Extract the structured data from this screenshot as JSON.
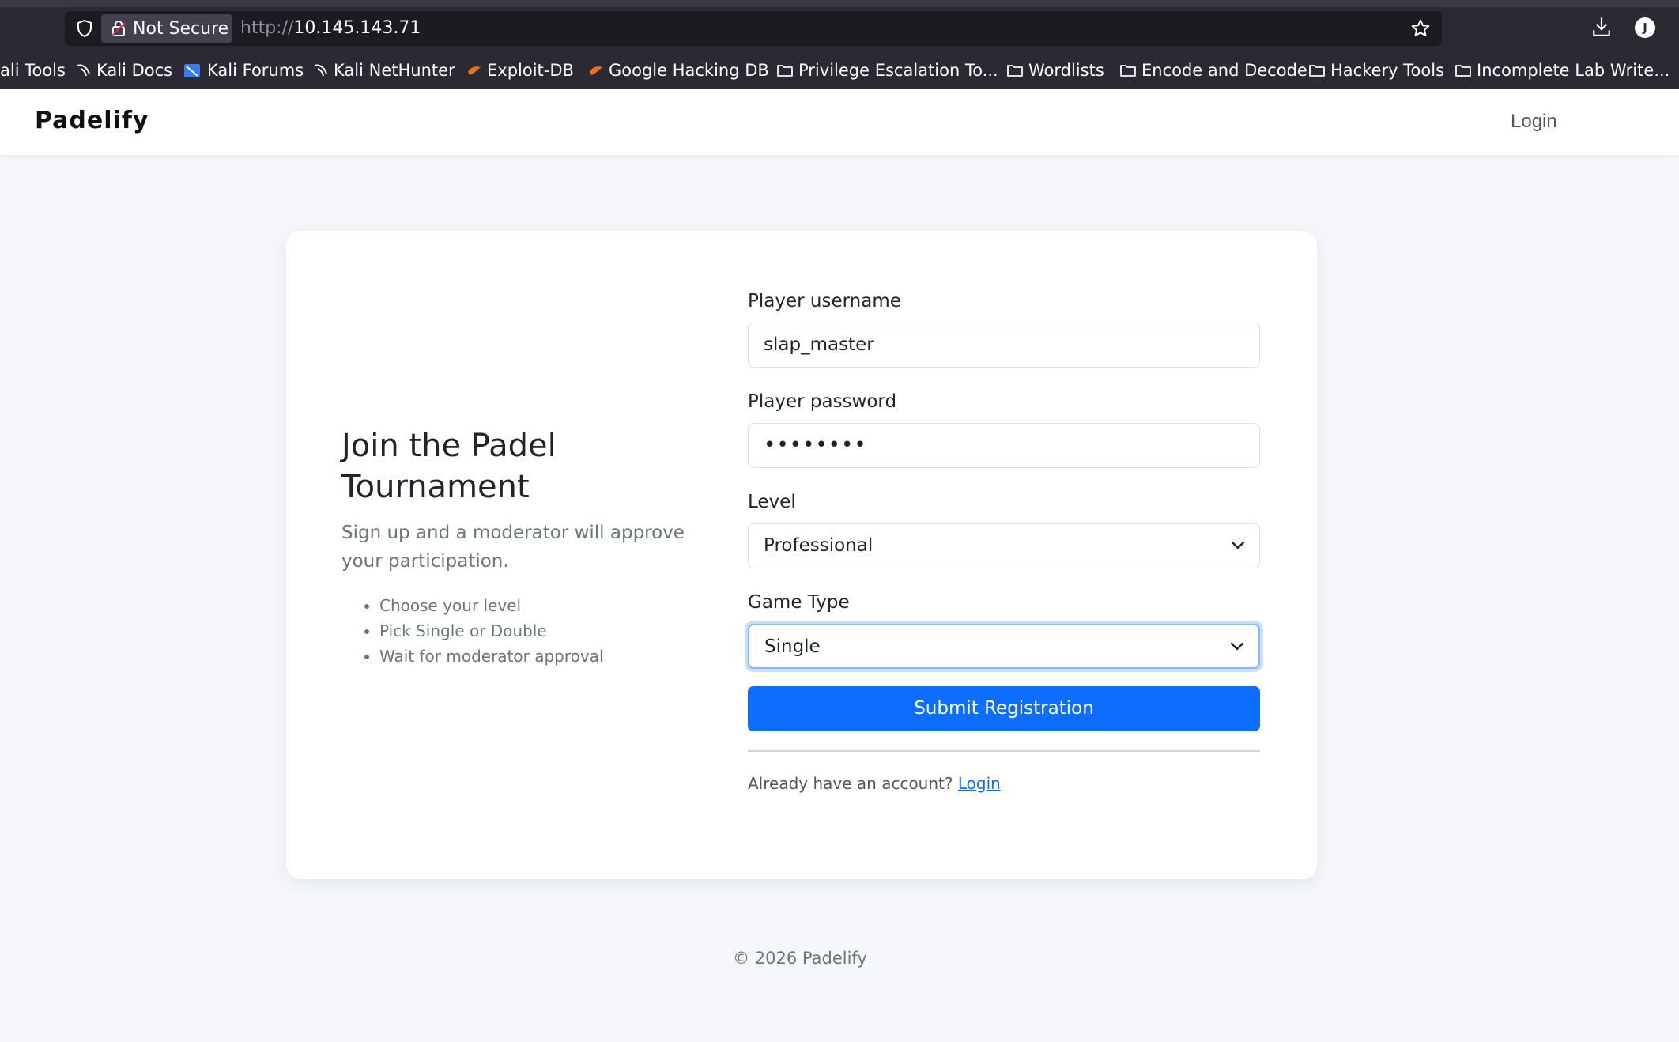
{
  "browser": {
    "security_label": "Not Secure",
    "url_protocol": "http://",
    "url_host": "10.145.143.71",
    "profile_initial": "J",
    "bookmarks": [
      {
        "label": "ali Tools",
        "icon": "none"
      },
      {
        "label": "Kali Docs",
        "icon": "kali-dragon-icon"
      },
      {
        "label": "Kali Forums",
        "icon": "kali-forums-icon"
      },
      {
        "label": "Kali NetHunter",
        "icon": "kali-dragon-icon"
      },
      {
        "label": "Exploit-DB",
        "icon": "exploitdb-icon"
      },
      {
        "label": "Google Hacking DB",
        "icon": "exploitdb-icon"
      },
      {
        "label": "Privilege Escalation To...",
        "icon": "folder-icon"
      },
      {
        "label": "Wordlists",
        "icon": "folder-icon"
      },
      {
        "label": "Encode and Decode",
        "icon": "folder-icon"
      },
      {
        "label": "Hackery Tools",
        "icon": "folder-icon"
      },
      {
        "label": "Incomplete Lab Write...",
        "icon": "folder-icon"
      }
    ]
  },
  "navbar": {
    "brand": "Padelify",
    "login_label": "Login"
  },
  "intro": {
    "title": "Join the Padel Tournament",
    "subtitle": "Sign up and a moderator will approve your participation.",
    "bullets": [
      "Choose your level",
      "Pick Single or Double",
      "Wait for moderator approval"
    ]
  },
  "form": {
    "username_label": "Player username",
    "username_value": "slap_master",
    "password_label": "Player password",
    "password_value": "••••••••",
    "level_label": "Level",
    "level_value": "Professional",
    "game_type_label": "Game Type",
    "game_type_value": "Single",
    "submit_label": "Submit Registration",
    "already_text": "Already have an account?",
    "login_link": "Login"
  },
  "footer": {
    "copyright": "© 2026 Padelify"
  },
  "colors": {
    "primary": "#0d6efd",
    "focus_ring": "#86b7fe",
    "chrome_bg": "#2b2a33"
  }
}
